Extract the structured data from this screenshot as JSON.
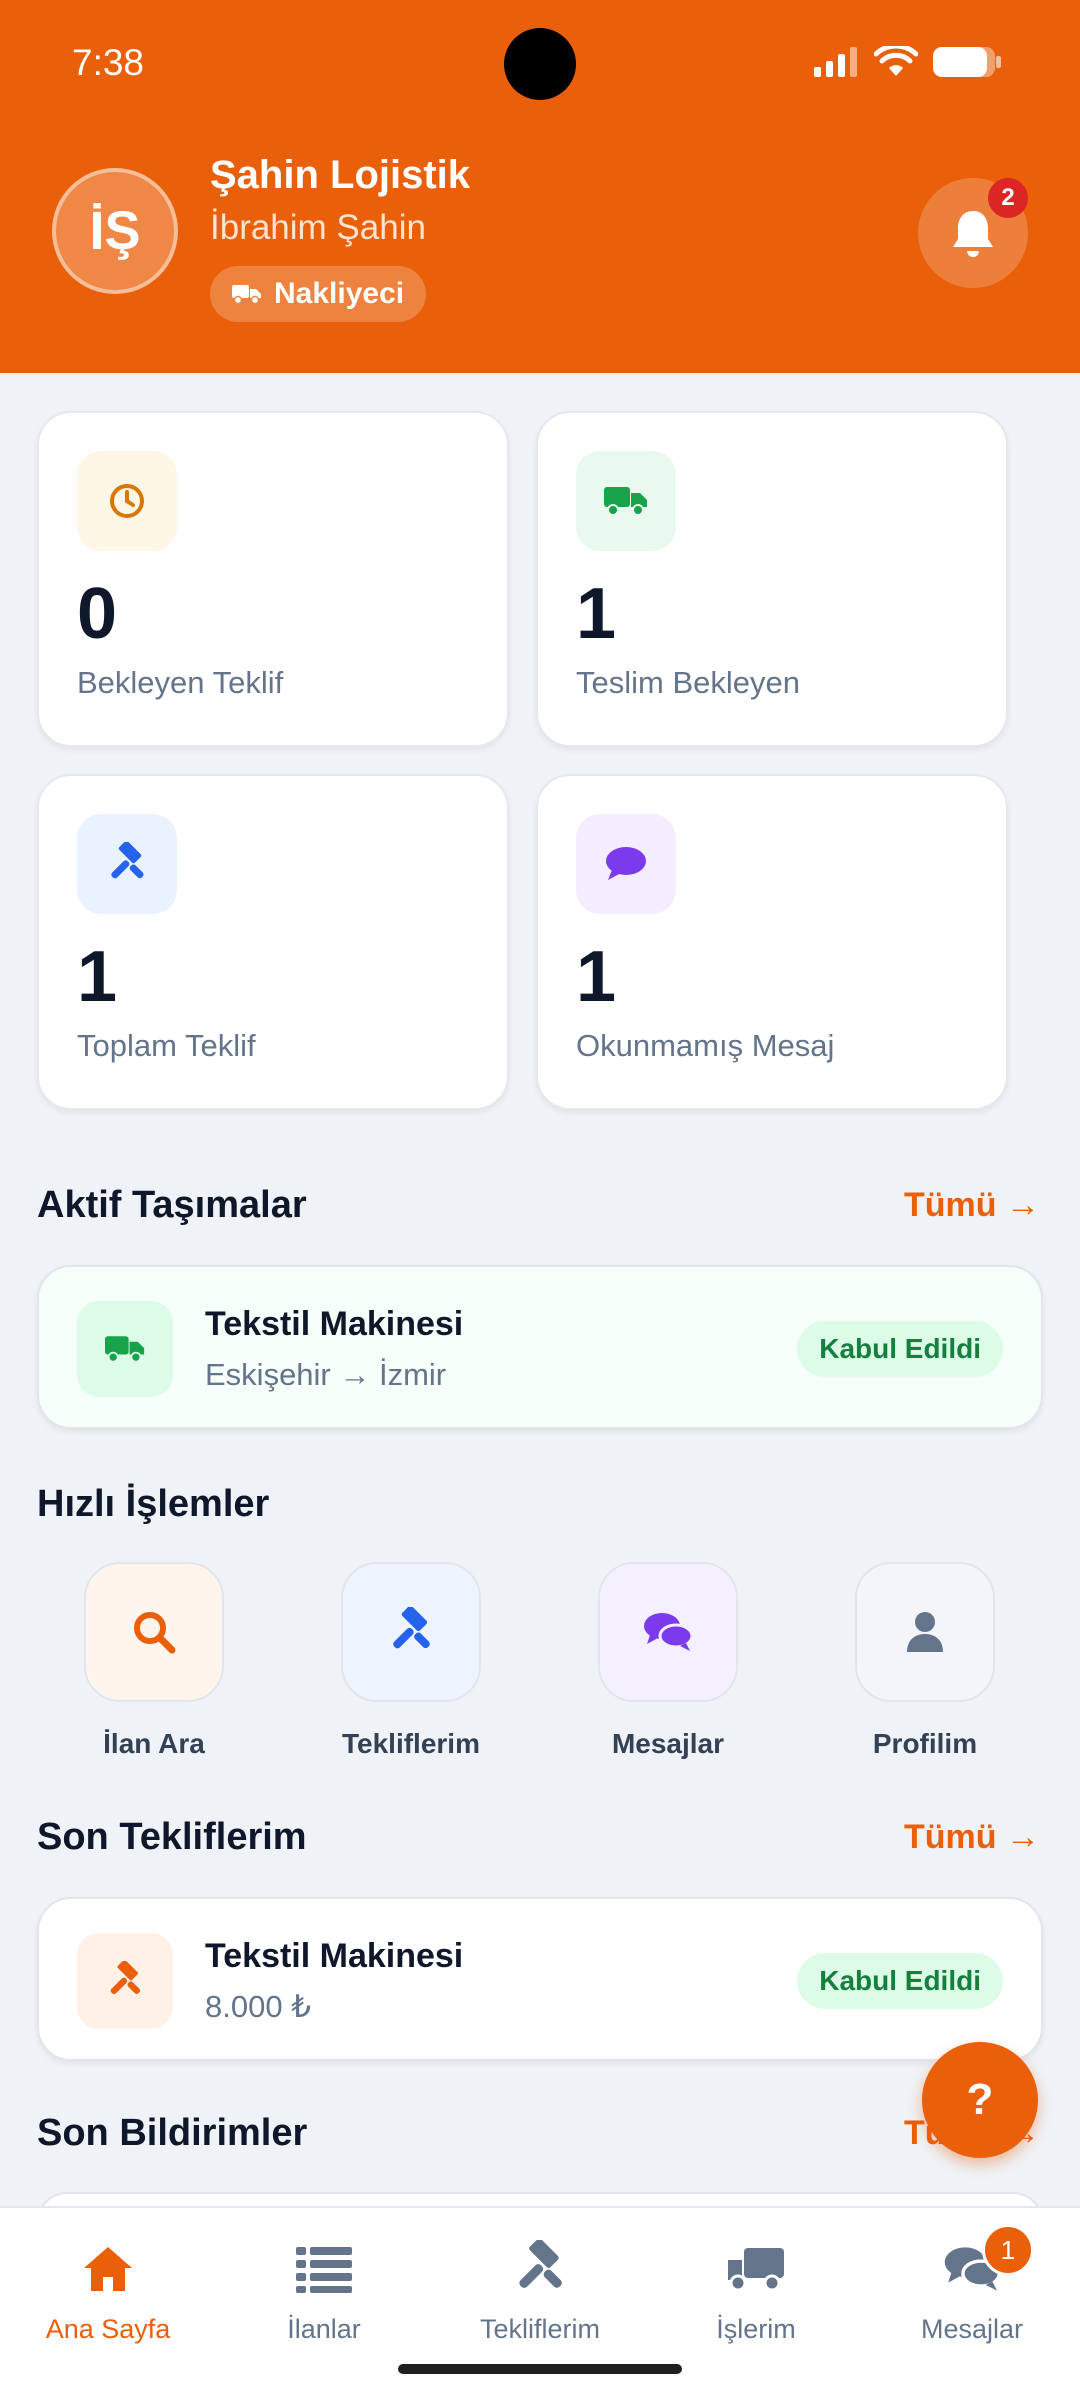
{
  "status_bar": {
    "time": "7:38"
  },
  "header": {
    "avatar_initials": "İŞ",
    "company_name": "Şahin Lojistik",
    "user_name": "İbrahim Şahin",
    "role_label": "Nakliyeci",
    "notification_count": "2"
  },
  "stats": [
    {
      "value": "0",
      "label": "Bekleyen Teklif",
      "icon": "clock-icon",
      "color": "#d97706"
    },
    {
      "value": "1",
      "label": "Teslim Bekleyen",
      "icon": "truck-icon",
      "color": "#16a34a"
    },
    {
      "value": "1",
      "label": "Toplam Teklif",
      "icon": "gavel-icon",
      "color": "#2563eb"
    },
    {
      "value": "1",
      "label": "Okunmamış Mesaj",
      "icon": "chat-bubble-icon",
      "color": "#7c3aed"
    }
  ],
  "active_shipments": {
    "title": "Aktif Taşımalar",
    "see_all": "Tümü →",
    "items": [
      {
        "title": "Tekstil Makinesi",
        "route": "Eskişehir → İzmir",
        "status": "Kabul Edildi"
      }
    ]
  },
  "quick_actions": {
    "title": "Hızlı İşlemler",
    "items": [
      {
        "label": "İlan Ara",
        "icon": "search-icon"
      },
      {
        "label": "Tekliflerim",
        "icon": "gavel-icon"
      },
      {
        "label": "Mesajlar",
        "icon": "chat-icon"
      },
      {
        "label": "Profilim",
        "icon": "user-icon"
      }
    ]
  },
  "recent_offers": {
    "title": "Son Tekliflerim",
    "see_all": "Tümü →",
    "items": [
      {
        "title": "Tekstil Makinesi",
        "amount": "8.000 ₺",
        "status": "Kabul Edildi"
      }
    ]
  },
  "recent_notifications": {
    "title": "Son Bildirimler",
    "see_all": "Tümü →"
  },
  "fab": {
    "label": "?"
  },
  "bottom_nav": {
    "items": [
      {
        "label": "Ana Sayfa",
        "icon": "home-icon",
        "active": true
      },
      {
        "label": "İlanlar",
        "icon": "list-icon"
      },
      {
        "label": "Tekliflerim",
        "icon": "gavel-icon"
      },
      {
        "label": "İşlerim",
        "icon": "truck-icon"
      },
      {
        "label": "Mesajlar",
        "icon": "chat-icon",
        "badge": "1"
      }
    ]
  },
  "colors": {
    "brand": "#ea5f09",
    "success": "#15803d",
    "badge_red": "#dc2626"
  }
}
